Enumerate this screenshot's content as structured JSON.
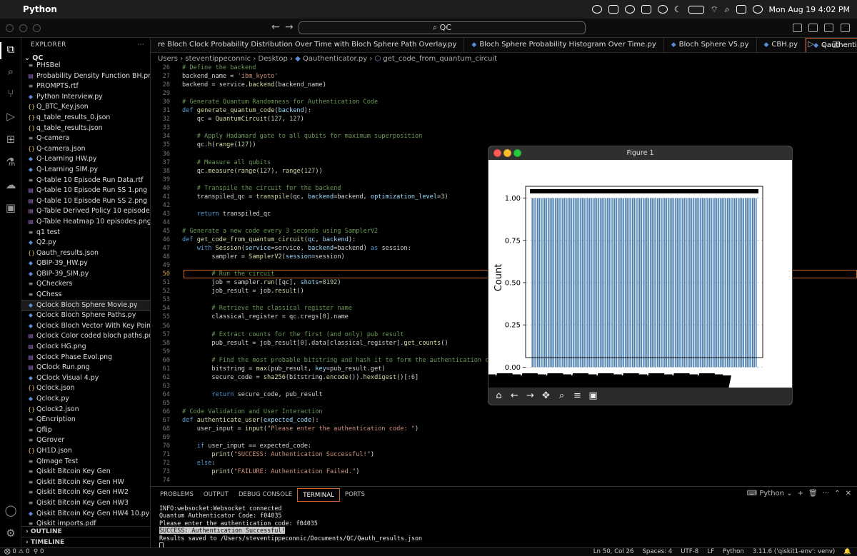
{
  "menubar": {
    "app": "Python",
    "datetime": "Mon Aug 19  4:02 PM"
  },
  "command_center": "QC",
  "sidebar": {
    "title": "EXPLORER",
    "root": "QC",
    "files": [
      {
        "name": "PHSBel",
        "type": "doc"
      },
      {
        "name": "Probability Density Function BH.png",
        "type": "img"
      },
      {
        "name": "PROMPTS.rtf",
        "type": "doc"
      },
      {
        "name": "Python Interview.py",
        "type": "py"
      },
      {
        "name": "Q_BTC_Key.json",
        "type": "json"
      },
      {
        "name": "q_table_results_0.json",
        "type": "json"
      },
      {
        "name": "q_table_results.json",
        "type": "json"
      },
      {
        "name": "Q-camera",
        "type": "doc"
      },
      {
        "name": "Q-camera.json",
        "type": "json"
      },
      {
        "name": "Q-Learning HW.py",
        "type": "py"
      },
      {
        "name": "Q-Learning SIM.py",
        "type": "py"
      },
      {
        "name": "Q-table 10 Episode Run Data.rtf",
        "type": "doc"
      },
      {
        "name": "Q-table 10 Episode Run SS 1.png",
        "type": "img"
      },
      {
        "name": "Q-table 10 Episode Run SS 2.png",
        "type": "img"
      },
      {
        "name": "Q-Table Derived Policy 10 episodes....",
        "type": "img"
      },
      {
        "name": "Q-Table Heatmap 10 episodes.png",
        "type": "img"
      },
      {
        "name": "q1 test",
        "type": "doc"
      },
      {
        "name": "Q2.py",
        "type": "py"
      },
      {
        "name": "Qauth_results.json",
        "type": "json"
      },
      {
        "name": "QBIP-39_HW.py",
        "type": "py"
      },
      {
        "name": "QBIP-39_SIM.py",
        "type": "py"
      },
      {
        "name": "QCheckers",
        "type": "doc"
      },
      {
        "name": "QChess",
        "type": "doc"
      },
      {
        "name": "Qclock Bloch Sphere Movie.py",
        "type": "py",
        "selected": true
      },
      {
        "name": "Qclock Bloch Sphere Paths.py",
        "type": "py"
      },
      {
        "name": "Qclock Bloch Vector With Key Points...",
        "type": "py"
      },
      {
        "name": "Qclock Color coded bloch paths.png",
        "type": "img"
      },
      {
        "name": "Qclock HG.png",
        "type": "img"
      },
      {
        "name": "Qclock Phase Evol.png",
        "type": "img"
      },
      {
        "name": "QClock Run.png",
        "type": "img"
      },
      {
        "name": "QClock Visual 4.py",
        "type": "py"
      },
      {
        "name": "Qclock.json",
        "type": "json"
      },
      {
        "name": "Qclock.py",
        "type": "py"
      },
      {
        "name": "Qclock2.json",
        "type": "json"
      },
      {
        "name": "QEncription",
        "type": "doc"
      },
      {
        "name": "Qflip",
        "type": "doc"
      },
      {
        "name": "QGrover",
        "type": "doc"
      },
      {
        "name": "QH1D.json",
        "type": "json"
      },
      {
        "name": "QImage Test",
        "type": "doc"
      },
      {
        "name": "Qiskit Bitcoin Key Gen",
        "type": "doc"
      },
      {
        "name": "Qiskit Bitcoin Key Gen HW",
        "type": "doc"
      },
      {
        "name": "Qiskit Bitcoin Key Gen HW2",
        "type": "doc"
      },
      {
        "name": "Qiskit Bitcoin Key Gen HW3",
        "type": "doc"
      },
      {
        "name": "Qiskit Bitcoin Key Gen HW4 10.py",
        "type": "py"
      },
      {
        "name": "Qiskit imports.pdf",
        "type": "doc"
      }
    ],
    "outline": "OUTLINE",
    "timeline": "TIMELINE"
  },
  "tabs": [
    {
      "label": "re Bloch Clock Probability Distribution Over Time with Bloch Sphere Path Overlay.py",
      "active": false
    },
    {
      "label": "Bloch Sphere Probability Histogram Over Time.py",
      "active": false
    },
    {
      "label": "Bloch Sphere V5.py",
      "active": false
    },
    {
      "label": "CBH.py",
      "active": false
    },
    {
      "label": "Qauthenticator.py",
      "active": true
    }
  ],
  "breadcrumb": [
    "Users",
    "steventippeconnic",
    "Desktop",
    "Qauthenticator.py",
    "get_code_from_quantum_circuit"
  ],
  "editor": {
    "current_line": 50,
    "lines": [
      {
        "n": "26",
        "html": "<span class='cm'># Define the backend</span>"
      },
      {
        "n": "27",
        "html": "backend_name = <span class='st'>'ibm_kyoto'</span>"
      },
      {
        "n": "28",
        "html": "backend = service.<span class='fn'>backend</span>(backend_name)"
      },
      {
        "n": "29",
        "html": ""
      },
      {
        "n": "30",
        "html": "<span class='cm'># Generate Quantum Randomness for Authentication Code</span>"
      },
      {
        "n": "31",
        "html": "<span class='kw'>def</span> <span class='fn'>generate_quantum_code</span>(<span class='pm'>backend</span>):"
      },
      {
        "n": "32",
        "html": "    qc = <span class='fn'>QuantumCircuit</span>(<span class='nm'>127</span>, <span class='nm'>127</span>)"
      },
      {
        "n": "33",
        "html": ""
      },
      {
        "n": "34",
        "html": "    <span class='cm'># Apply Hadamard gate to all qubits for maximum superposition</span>"
      },
      {
        "n": "35",
        "html": "    qc.<span class='fn'>h</span>(<span class='fn'>range</span>(<span class='nm'>127</span>))"
      },
      {
        "n": "36",
        "html": ""
      },
      {
        "n": "37",
        "html": "    <span class='cm'># Measure all qubits</span>"
      },
      {
        "n": "38",
        "html": "    qc.<span class='fn'>measure</span>(<span class='fn'>range</span>(<span class='nm'>127</span>), <span class='fn'>range</span>(<span class='nm'>127</span>))"
      },
      {
        "n": "39",
        "html": ""
      },
      {
        "n": "40",
        "html": "    <span class='cm'># Transpile the circuit for the backend</span>"
      },
      {
        "n": "41",
        "html": "    transpiled_qc = <span class='fn'>transpile</span>(qc, <span class='pm'>backend</span>=backend, <span class='pm'>optimization_level</span>=<span class='nm'>3</span>)"
      },
      {
        "n": "42",
        "html": ""
      },
      {
        "n": "43",
        "html": "    <span class='kw'>return</span> transpiled_qc"
      },
      {
        "n": "44",
        "html": ""
      },
      {
        "n": "45",
        "html": "<span class='cm'># Generate a new code every 3 seconds using SamplerV2</span>"
      },
      {
        "n": "46",
        "html": "<span class='kw'>def</span> <span class='fn'>get_code_from_quantum_circuit</span>(<span class='pm'>qc</span>, <span class='pm'>backend</span>):"
      },
      {
        "n": "47",
        "html": "    <span class='kw'>with</span> <span class='fn'>Session</span>(<span class='pm'>service</span>=service, <span class='pm'>backend</span>=backend) <span class='kw'>as</span> session:"
      },
      {
        "n": "48",
        "html": "        sampler = <span class='fn'>SamplerV2</span>(<span class='pm'>session</span>=session)"
      },
      {
        "n": "49",
        "html": ""
      },
      {
        "n": "50",
        "html": "        <span class='cm'># Run the circuit</span>"
      },
      {
        "n": "51",
        "html": "        job = sampler.<span class='fn'>run</span>([qc], <span class='pm'>shots</span>=<span class='nm'>8192</span>)"
      },
      {
        "n": "52",
        "html": "        job_result = job.<span class='fn'>result</span>()"
      },
      {
        "n": "53",
        "html": ""
      },
      {
        "n": "54",
        "html": "        <span class='cm'># Retrieve the classical register name</span>"
      },
      {
        "n": "55",
        "html": "        classical_register = qc.cregs[<span class='nm'>0</span>].name"
      },
      {
        "n": "56",
        "html": ""
      },
      {
        "n": "57",
        "html": "        <span class='cm'># Extract counts for the first (and only) pub result</span>"
      },
      {
        "n": "58",
        "html": "        pub_result = job_result[<span class='nm'>0</span>].data[classical_register].<span class='fn'>get_counts</span>()"
      },
      {
        "n": "59",
        "html": ""
      },
      {
        "n": "60",
        "html": "        <span class='cm'># Find the most probable bitstring and hash it to form the authentication code</span>"
      },
      {
        "n": "61",
        "html": "        bitstring = <span class='fn'>max</span>(pub_result, <span class='pm'>key</span>=pub_result.get)"
      },
      {
        "n": "62",
        "html": "        secure_code = <span class='fn'>sha256</span>(bitstring.<span class='fn'>encode</span>()).<span class='fn'>hexdigest</span>()[:<span class='nm'>6</span>]"
      },
      {
        "n": "63",
        "html": ""
      },
      {
        "n": "64",
        "html": "        <span class='kw'>return</span> secure_code, pub_result"
      },
      {
        "n": "65",
        "html": ""
      },
      {
        "n": "66",
        "html": "<span class='cm'># Code Validation and User Interaction</span>"
      },
      {
        "n": "67",
        "html": "<span class='kw'>def</span> <span class='fn'>authenticate_user</span>(<span class='pm'>expected_code</span>):"
      },
      {
        "n": "68",
        "html": "    user_input = <span class='fn'>input</span>(<span class='st'>\"Please enter the authentication code: \"</span>)"
      },
      {
        "n": "69",
        "html": ""
      },
      {
        "n": "70",
        "html": "    <span class='kw'>if</span> user_input == expected_code:"
      },
      {
        "n": "71",
        "html": "        <span class='fn'>print</span>(<span class='st'>\"SUCCESS: Authentication Successful!\"</span>)"
      },
      {
        "n": "72",
        "html": "    <span class='kw'>else</span>:"
      },
      {
        "n": "73",
        "html": "        <span class='fn'>print</span>(<span class='st'>\"FAILURE: Authentication Failed.\"</span>)"
      },
      {
        "n": "74",
        "html": ""
      }
    ]
  },
  "figure": {
    "title": "Figure 1",
    "ylabel": "Count",
    "yticks": [
      "0.00",
      "0.25",
      "0.50",
      "0.75",
      "1.00"
    ],
    "bar_count": 126,
    "bar_value": 1.0,
    "ylim": [
      -0.07,
      1.07
    ],
    "bar_color": "#4a7fb0",
    "toolbar": [
      "home-icon",
      "back-icon",
      "forward-icon",
      "pan-icon",
      "zoom-icon",
      "configure-icon",
      "save-icon"
    ]
  },
  "panel": {
    "tabs": [
      "PROBLEMS",
      "OUTPUT",
      "DEBUG CONSOLE",
      "TERMINAL",
      "PORTS"
    ],
    "active_tab": "TERMINAL",
    "shell": "Python",
    "terminal": [
      "INFO:websocket:Websocket connected",
      "Quantum Authenticator Code: f04035",
      "Please enter the authentication code: f04035",
      "SUCCESS: Authentication Successful!",
      "Results saved to /Users/steventippeconnic/Documents/QC/Qauth_results.json"
    ]
  },
  "status": {
    "errors": "0",
    "warnings": "0",
    "ports": "0",
    "position": "Ln 50, Col 26",
    "spaces": "Spaces: 4",
    "encoding": "UTF-8",
    "eol": "LF",
    "language": "Python",
    "interpreter": "3.11.6 ('qiskit1-env': venv)"
  }
}
